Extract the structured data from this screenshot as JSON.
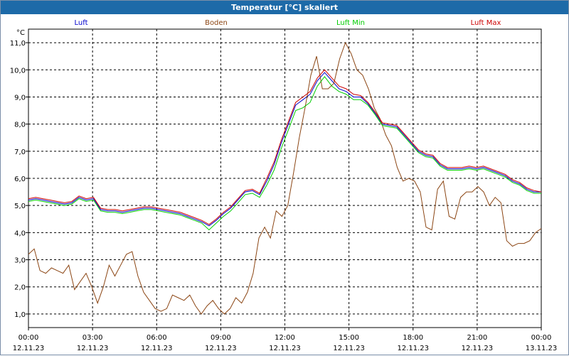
{
  "window": {
    "title": "Temperatur [°C] skaliert"
  },
  "chart_data": {
    "type": "line",
    "y_unit": "°C",
    "ylim": [
      0.5,
      11.5
    ],
    "y_ticks": [
      "1,0",
      "2,0",
      "3,0",
      "4,0",
      "5,0",
      "6,0",
      "7,0",
      "8,0",
      "9,0",
      "10,0",
      "11,0"
    ],
    "x_range_hours": [
      0,
      24
    ],
    "x_ticks": [
      {
        "time": "00:00",
        "date": "12.11.23"
      },
      {
        "time": "03:00",
        "date": "12.11.23"
      },
      {
        "time": "06:00",
        "date": "12.11.23"
      },
      {
        "time": "09:00",
        "date": "12.11.23"
      },
      {
        "time": "12:00",
        "date": "12.11.23"
      },
      {
        "time": "15:00",
        "date": "12.11.23"
      },
      {
        "time": "18:00",
        "date": "12.11.23"
      },
      {
        "time": "21:00",
        "date": "12.11.23"
      },
      {
        "time": "00:00",
        "date": "13.11.23"
      }
    ],
    "grid": true,
    "series": [
      {
        "name": "Luft",
        "color": "#0000cc",
        "values": [
          5.2,
          5.25,
          5.2,
          5.15,
          5.1,
          5.05,
          5.1,
          5.3,
          5.2,
          5.25,
          4.85,
          4.8,
          4.8,
          4.75,
          4.8,
          4.85,
          4.9,
          4.9,
          4.85,
          4.8,
          4.75,
          4.7,
          4.6,
          4.5,
          4.4,
          4.25,
          4.45,
          4.7,
          4.9,
          5.2,
          5.5,
          5.55,
          5.4,
          5.9,
          6.5,
          7.3,
          8.0,
          8.7,
          8.9,
          9.1,
          9.6,
          9.9,
          9.6,
          9.3,
          9.2,
          9.0,
          9.0,
          8.75,
          8.4,
          8.0,
          7.95,
          7.9,
          7.6,
          7.3,
          7.0,
          6.85,
          6.8,
          6.5,
          6.35,
          6.35,
          6.35,
          6.4,
          6.35,
          6.4,
          6.3,
          6.2,
          6.1,
          5.9,
          5.8,
          5.6,
          5.5,
          5.5
        ]
      },
      {
        "name": "Boden",
        "color": "#8b4513",
        "values": [
          3.2,
          3.4,
          2.6,
          2.5,
          2.7,
          2.6,
          2.5,
          2.8,
          1.9,
          2.2,
          2.5,
          2.0,
          1.4,
          2.0,
          2.8,
          2.4,
          2.8,
          3.2,
          3.3,
          2.4,
          1.8,
          1.5,
          1.2,
          1.1,
          1.2,
          1.7,
          1.6,
          1.5,
          1.7,
          1.3,
          1.0,
          1.3,
          1.5,
          1.2,
          1.0,
          1.2,
          1.6,
          1.4,
          1.8,
          2.5,
          3.8,
          4.2,
          3.8,
          4.8,
          4.6,
          5.0,
          6.2,
          7.5,
          8.6,
          9.8,
          10.5,
          9.3,
          9.3,
          9.5,
          10.4,
          11.0,
          10.6,
          10.0,
          9.8,
          9.3,
          8.6,
          8.2,
          7.6,
          7.2,
          6.4,
          5.9,
          6.0,
          5.9,
          5.5,
          4.2,
          4.1,
          5.6,
          5.9,
          4.6,
          4.5,
          5.3,
          5.5,
          5.5,
          5.7,
          5.5,
          5.0,
          5.3,
          5.1,
          3.7,
          3.5,
          3.6,
          3.6,
          3.7,
          4.0,
          4.15
        ]
      },
      {
        "name": "Luft Min",
        "color": "#00cc00",
        "values": [
          5.15,
          5.2,
          5.15,
          5.1,
          5.05,
          5.0,
          5.05,
          5.25,
          5.15,
          5.2,
          4.8,
          4.75,
          4.75,
          4.7,
          4.75,
          4.8,
          4.85,
          4.85,
          4.8,
          4.75,
          4.7,
          4.65,
          4.55,
          4.45,
          4.35,
          4.1,
          4.35,
          4.6,
          4.8,
          5.1,
          5.4,
          5.45,
          5.3,
          5.75,
          6.3,
          7.1,
          7.8,
          8.5,
          8.6,
          8.8,
          9.4,
          9.75,
          9.4,
          9.2,
          9.1,
          8.9,
          8.9,
          8.7,
          8.35,
          7.95,
          7.9,
          7.85,
          7.55,
          7.25,
          6.95,
          6.8,
          6.75,
          6.45,
          6.3,
          6.3,
          6.3,
          6.35,
          6.3,
          6.35,
          6.25,
          6.15,
          6.05,
          5.85,
          5.75,
          5.55,
          5.45,
          5.45
        ]
      },
      {
        "name": "Luft Max",
        "color": "#cc0000",
        "values": [
          5.25,
          5.3,
          5.25,
          5.2,
          5.15,
          5.1,
          5.15,
          5.35,
          5.25,
          5.3,
          4.9,
          4.85,
          4.85,
          4.8,
          4.85,
          4.9,
          4.95,
          4.95,
          4.9,
          4.85,
          4.8,
          4.75,
          4.65,
          4.55,
          4.45,
          4.3,
          4.5,
          4.75,
          4.95,
          5.25,
          5.55,
          5.6,
          5.45,
          6.0,
          6.6,
          7.4,
          8.1,
          8.8,
          9.0,
          9.2,
          9.7,
          10.0,
          9.7,
          9.4,
          9.3,
          9.1,
          9.05,
          8.8,
          8.45,
          8.05,
          8.0,
          7.95,
          7.65,
          7.35,
          7.05,
          6.9,
          6.85,
          6.55,
          6.4,
          6.4,
          6.4,
          6.45,
          6.4,
          6.45,
          6.35,
          6.25,
          6.15,
          5.95,
          5.85,
          5.65,
          5.55,
          5.5
        ]
      }
    ]
  }
}
